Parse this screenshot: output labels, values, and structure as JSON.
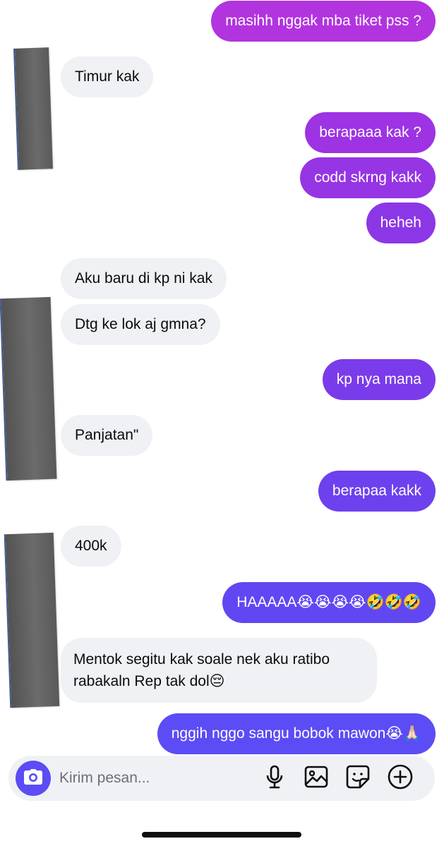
{
  "messages": [
    {
      "text": "masihh nggak mba tiket pss ?"
    },
    {
      "text": "Timur kak"
    },
    {
      "text": "berapaaa kak ?"
    },
    {
      "text": "codd skrng kakk"
    },
    {
      "text": "heheh"
    },
    {
      "text": "Aku baru di kp ni kak"
    },
    {
      "text": "Dtg ke lok aj gmna?"
    },
    {
      "text": "kp nya mana"
    },
    {
      "text": "Panjatan\""
    },
    {
      "text": "berapaa kakk"
    },
    {
      "text": "400k"
    },
    {
      "text": "HAAAAA😭😭😭😭🤣🤣🤣"
    },
    {
      "text": "Mentok segitu kak soale nek aku ratibo rabakaln Rep tak dol😔"
    },
    {
      "text": "nggih nggo sangu bobok mawon😭🙏🏻"
    }
  ],
  "composer": {
    "placeholder": "Kirim pesan...",
    "icons": [
      "camera-icon",
      "microphone-icon",
      "image-icon",
      "sticker-icon",
      "add-circle-icon"
    ]
  },
  "colors": {
    "incoming_bubble": "#eff1f4",
    "outgoing_gradient_top": "#b234df",
    "outgoing_gradient_bottom": "#5b4cf5",
    "camera_button": "#5b4cf5"
  }
}
